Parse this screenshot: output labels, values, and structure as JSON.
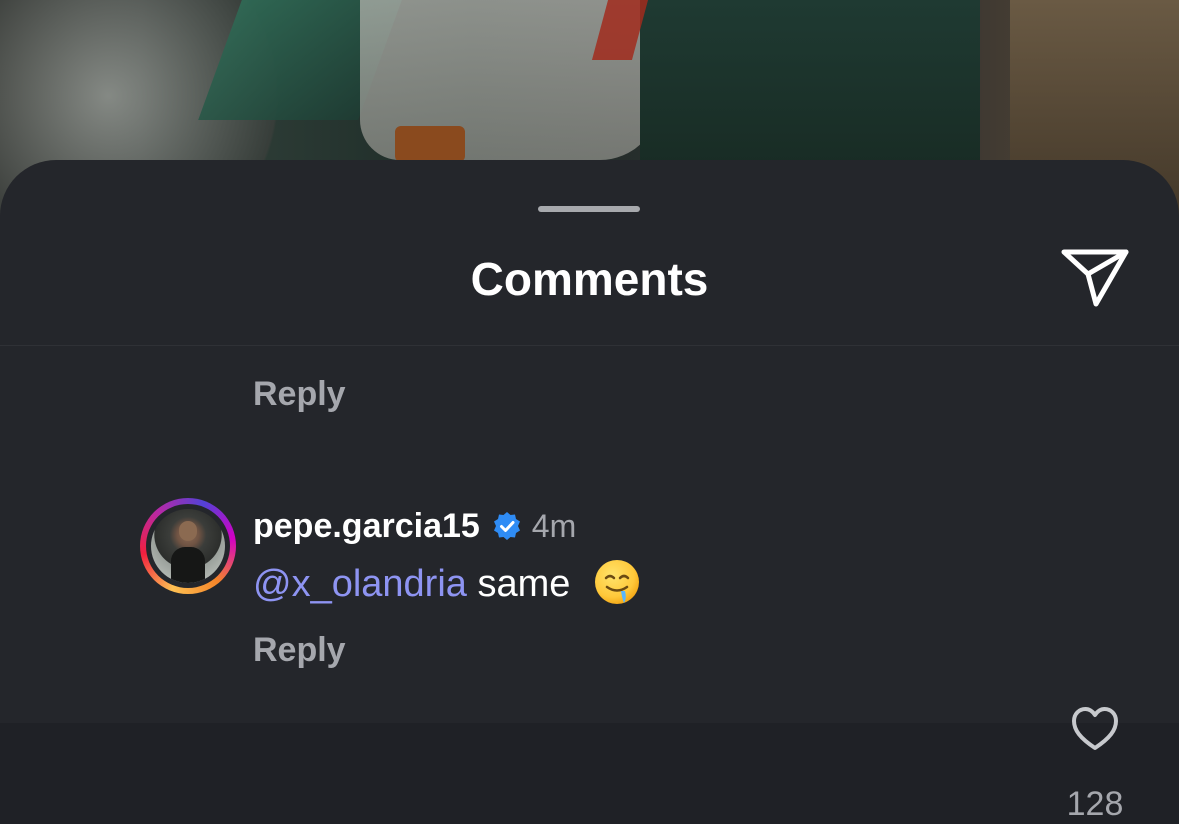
{
  "header": {
    "title": "Comments",
    "share_icon": "send-paper-plane-icon"
  },
  "reply_label": "Reply",
  "comment": {
    "username": "pepe.garcia15",
    "verified": true,
    "time": "4m",
    "mention": "@x_olandria",
    "text": "same",
    "emoji": "drooling-face-emoji",
    "reply_label": "Reply",
    "like_icon": "heart-outline-icon",
    "like_count": "128"
  },
  "colors": {
    "sheet_bg": "#24262b",
    "mention": "#8e94f2",
    "verified": "#2f8cf5",
    "secondary_text": "#a5a7ad"
  }
}
